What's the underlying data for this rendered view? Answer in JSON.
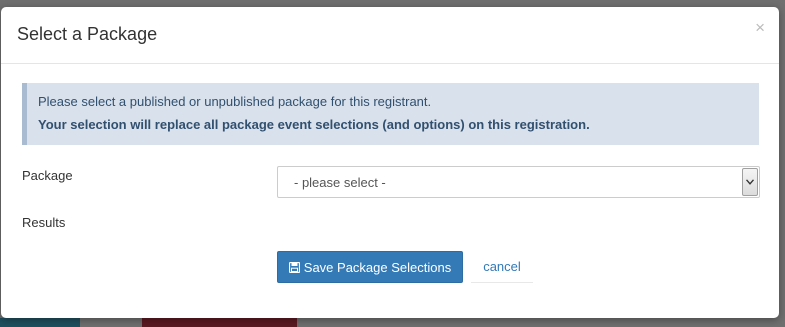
{
  "modal": {
    "title": "Select a Package",
    "close_glyph": "×"
  },
  "alert": {
    "line1": "Please select a published or unpublished package for this registrant.",
    "line2": "Your selection will replace all package event selections (and options) on this registration."
  },
  "form": {
    "package_label": "Package",
    "package_selected": "- please select -",
    "results_label": "Results"
  },
  "actions": {
    "save_label": "Save Package Selections",
    "save_icon": "floppy-disk-icon",
    "cancel_label": "cancel"
  },
  "colors": {
    "primary": "#337ab7",
    "alert_background": "#d9e1ec",
    "alert_text": "#31506f"
  }
}
